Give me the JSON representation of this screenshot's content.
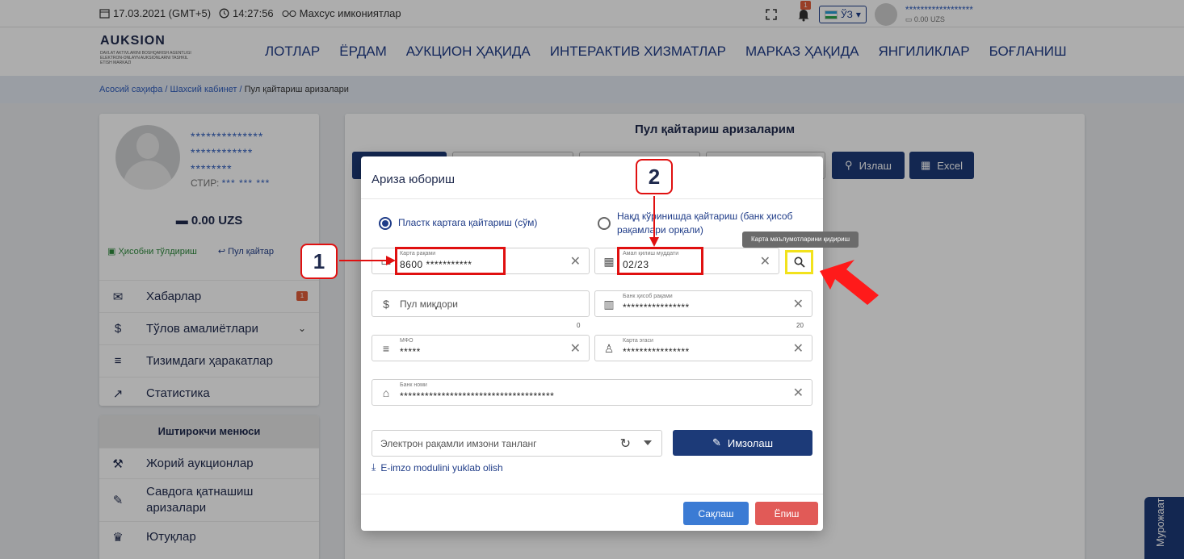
{
  "topbar": {
    "date": "17.03.2021 (GMT+5)",
    "time": "14:27:56",
    "accessibility": "Махсус имкониятлар",
    "notif_count": "1",
    "lang": "ЎЗ",
    "user_name": "******************",
    "user_balance": "0.00 UZS"
  },
  "header": {
    "logo": "AUKSION",
    "logo_sub": "DAVLAT AKTIVLARINI BOSHQARISH AGENTLIGI ELEKTRON-ONLAYN AUKSIONLARNI TASHKIL ETISH MARKAZI",
    "nav": [
      "ЛОТЛАР",
      "ЁРДАМ",
      "АУКЦИОН ҲАҚИДА",
      "ИНТЕРАКТИВ ХИЗМАТЛАР",
      "МАРКАЗ ҲАҚИДА",
      "ЯНГИЛИКЛАР",
      "БОҒЛАНИШ"
    ]
  },
  "breadcrumb": {
    "home": "Асосий саҳифа",
    "cabinet": "Шахсий кабинет",
    "current": "Пул қайтариш аризалари"
  },
  "profile": {
    "name_line1": "**************",
    "name_line2": "************",
    "name_line3": "********",
    "stir_label": "СТИР:",
    "stir_value": "*** *** ***",
    "balance": "0.00 UZS",
    "topup": "Ҳисобни тўлдириш",
    "refund": "Пул қайтар"
  },
  "menu": {
    "messages": "Хабарлар",
    "messages_badge": "1",
    "payments": "Тўлов амалиётлари",
    "actions": "Тизимдаги ҳаракатлар",
    "stats": "Статистика"
  },
  "participant_menu": {
    "title": "Иштирокчи менюси",
    "current_auctions": "Жорий аукционлар",
    "trade_requests": "Савдога қатнашиш аризалари",
    "wins": "Ютуқлар"
  },
  "panel": {
    "title": "Пул қайтариш аризаларим",
    "search": "Излаш",
    "excel": "Excel"
  },
  "modal": {
    "title": "Ариза юбориш",
    "radio_card": "Пластк картага қайтариш (сўм)",
    "radio_cash": "Нақд кўринишда қайтариш (банк ҳисоб рақамлари орқали)",
    "card_number_label": "Карта рақами",
    "card_number_value": "8600 ***********",
    "expiry_label": "Амал қилиш муддати",
    "expiry_value": "02/23",
    "tooltip": "Карта маълумотларини қидириш",
    "amount_placeholder": "Пул миқдори",
    "amount_counter": "0",
    "bank_account_label": "Банк ҳисоб рақами",
    "bank_account_value": "****************",
    "bank_account_counter": "20",
    "mfo_label": "МФО",
    "mfo_value": "*****",
    "card_owner_label": "Карта эгаси",
    "card_owner_value": "****************",
    "bank_name_label": "Банк номи",
    "bank_name_value": "*************************************",
    "sign_placeholder": "Электрон рақамли имзони танланг",
    "sign_button": "Имзолаш",
    "download_link": "E-imzo modulini yuklab olish",
    "save_button": "Сақлаш",
    "close_button": "Ёпиш"
  },
  "annotations": {
    "callout1": "1",
    "callout2": "2"
  },
  "side_tab": "Мурожаат",
  "colors": {
    "primary": "#1c3a78",
    "save": "#3b7bd4",
    "close": "#e15a57",
    "highlight_red": "#e01010",
    "highlight_yellow": "#f2e21c"
  }
}
